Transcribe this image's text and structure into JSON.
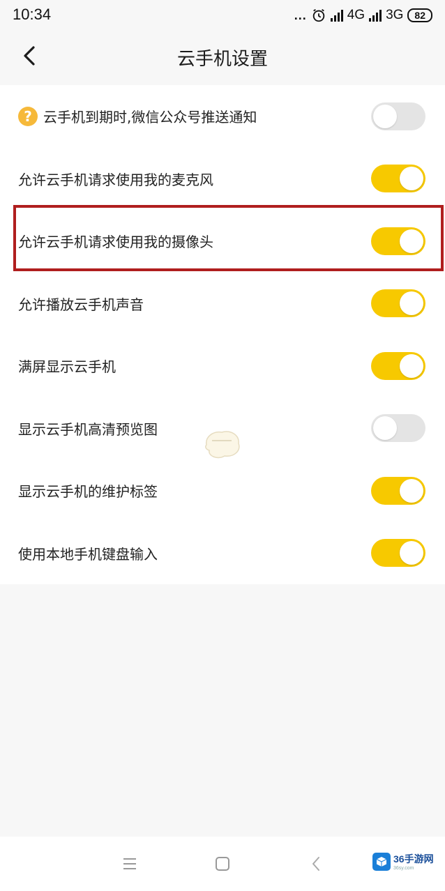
{
  "status_bar": {
    "time": "10:34",
    "dots": "...",
    "network_1": "4G",
    "network_2": "3G",
    "battery": "82"
  },
  "header": {
    "title": "云手机设置"
  },
  "settings": [
    {
      "label": "云手机到期时,微信公众号推送通知",
      "enabled": false,
      "has_help_icon": true
    },
    {
      "label": "允许云手机请求使用我的麦克风",
      "enabled": true
    },
    {
      "label": "允许云手机请求使用我的摄像头",
      "enabled": true
    },
    {
      "label": "允许播放云手机声音",
      "enabled": true
    },
    {
      "label": "满屏显示云手机",
      "enabled": true
    },
    {
      "label": "显示云手机高清预览图",
      "enabled": false
    },
    {
      "label": "显示云手机的维护标签",
      "enabled": true
    },
    {
      "label": "使用本地手机键盘输入",
      "enabled": true
    }
  ],
  "help_icon_glyph": "?",
  "watermark": {
    "text": "36手游网",
    "sub": "36sy.com"
  },
  "colors": {
    "toggle_on": "#f7c900",
    "toggle_off": "#e4e4e4",
    "highlight": "#b01e1e",
    "help_icon": "#f6b93a"
  },
  "icons": {
    "back": "chevron-left-icon",
    "alarm": "alarm-clock-icon",
    "menu": "menu-icon",
    "home": "home-square-icon",
    "nav_back": "triangle-back-icon"
  }
}
